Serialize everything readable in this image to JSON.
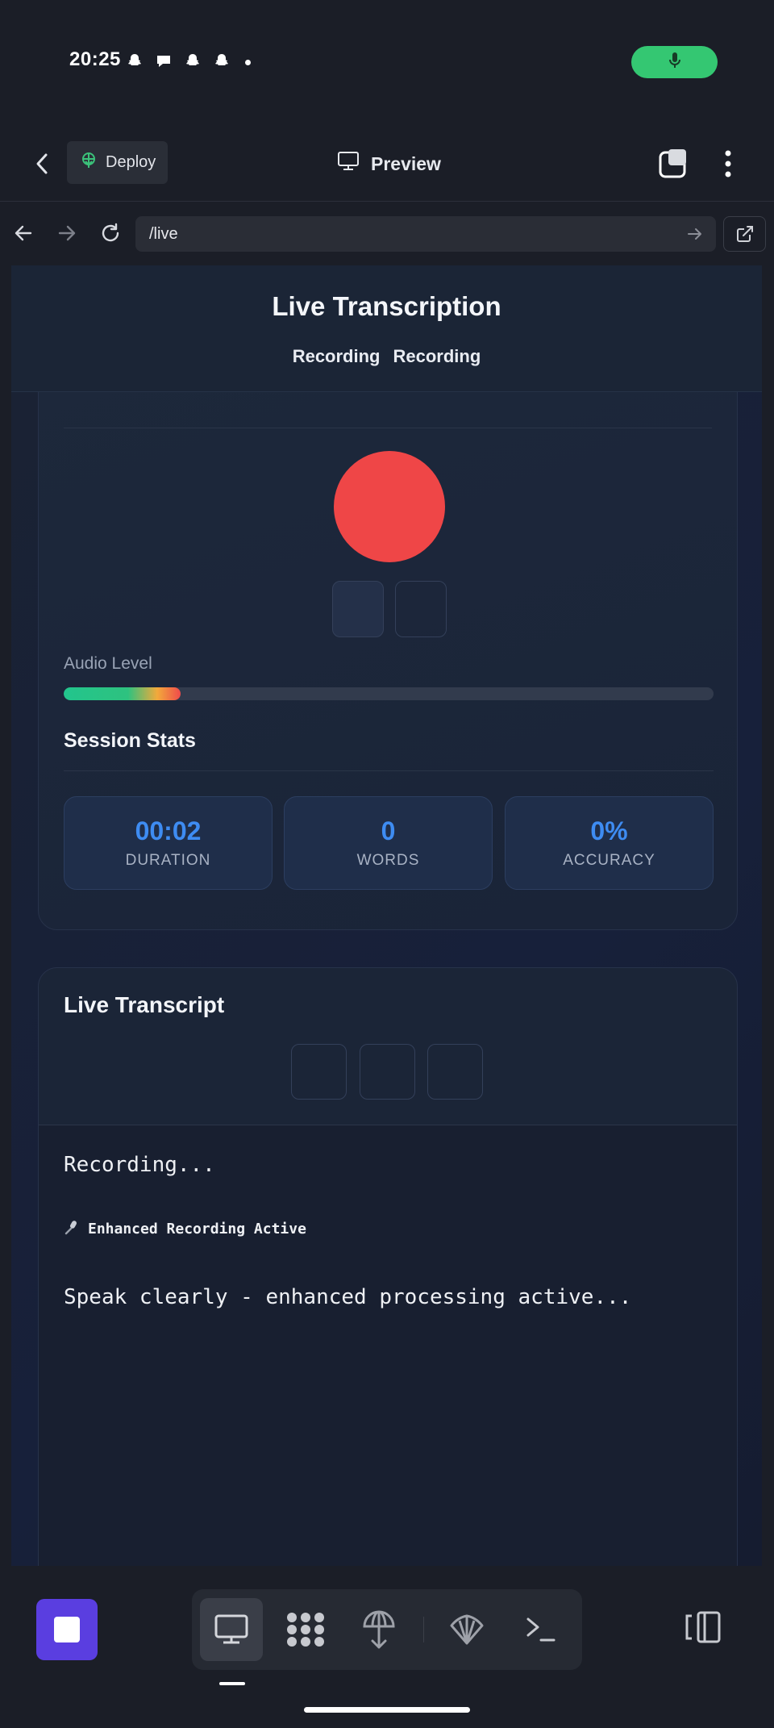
{
  "status_bar": {
    "time": "20:25",
    "notification_icons": [
      "snapchat-icon",
      "chat-bubble-icon",
      "snapchat-icon",
      "snapchat-icon"
    ],
    "mic_indicator_color": "#34c772"
  },
  "app_bar": {
    "deploy_label": "Deploy",
    "preview_label": "Preview"
  },
  "browser": {
    "url": "/live"
  },
  "page": {
    "title": "Live Transcription",
    "status_items": [
      "Recording",
      "Recording"
    ],
    "record_button_color": "#ef4647",
    "audio_level_label": "Audio Level",
    "audio_level_fraction": 0.18,
    "session_stats_title": "Session Stats",
    "stats": [
      {
        "value": "00:02",
        "label": "DURATION"
      },
      {
        "value": "0",
        "label": "WORDS"
      },
      {
        "value": "0%",
        "label": "ACCURACY"
      }
    ],
    "transcript_title": "Live Transcript",
    "transcript_status": "Recording...",
    "enhanced_label": "Enhanced Recording Active",
    "hint": "Speak clearly - enhanced processing active..."
  },
  "bottom_bar": {
    "tools": [
      "monitor-icon",
      "grid-dots-icon",
      "deploy-icon",
      "shell-icon",
      "terminal-icon"
    ],
    "accent": "#5a3ee0"
  }
}
